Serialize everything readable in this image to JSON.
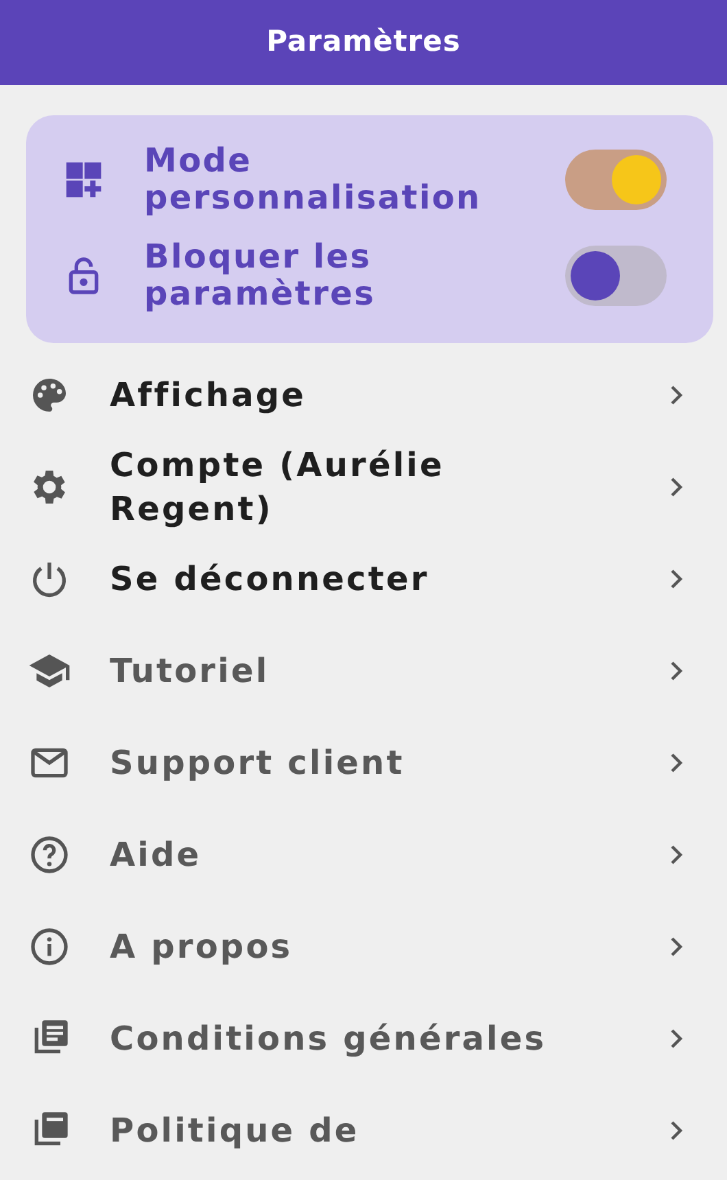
{
  "header": {
    "title": "Paramètres"
  },
  "quick_settings": [
    {
      "label": "Mode personnalisation",
      "on": true
    },
    {
      "label": "Bloquer les paramètres",
      "on": false
    }
  ],
  "menu": [
    {
      "label": "Affichage",
      "muted": false
    },
    {
      "label": "Compte (Aurélie Regent)",
      "muted": false
    },
    {
      "label": "Se déconnecter",
      "muted": false
    },
    {
      "label": "Tutoriel",
      "muted": true
    },
    {
      "label": "Support client",
      "muted": true
    },
    {
      "label": "Aide",
      "muted": true
    },
    {
      "label": "A propos",
      "muted": true
    },
    {
      "label": "Conditions générales",
      "muted": true
    },
    {
      "label": "Politique de",
      "muted": true
    }
  ]
}
